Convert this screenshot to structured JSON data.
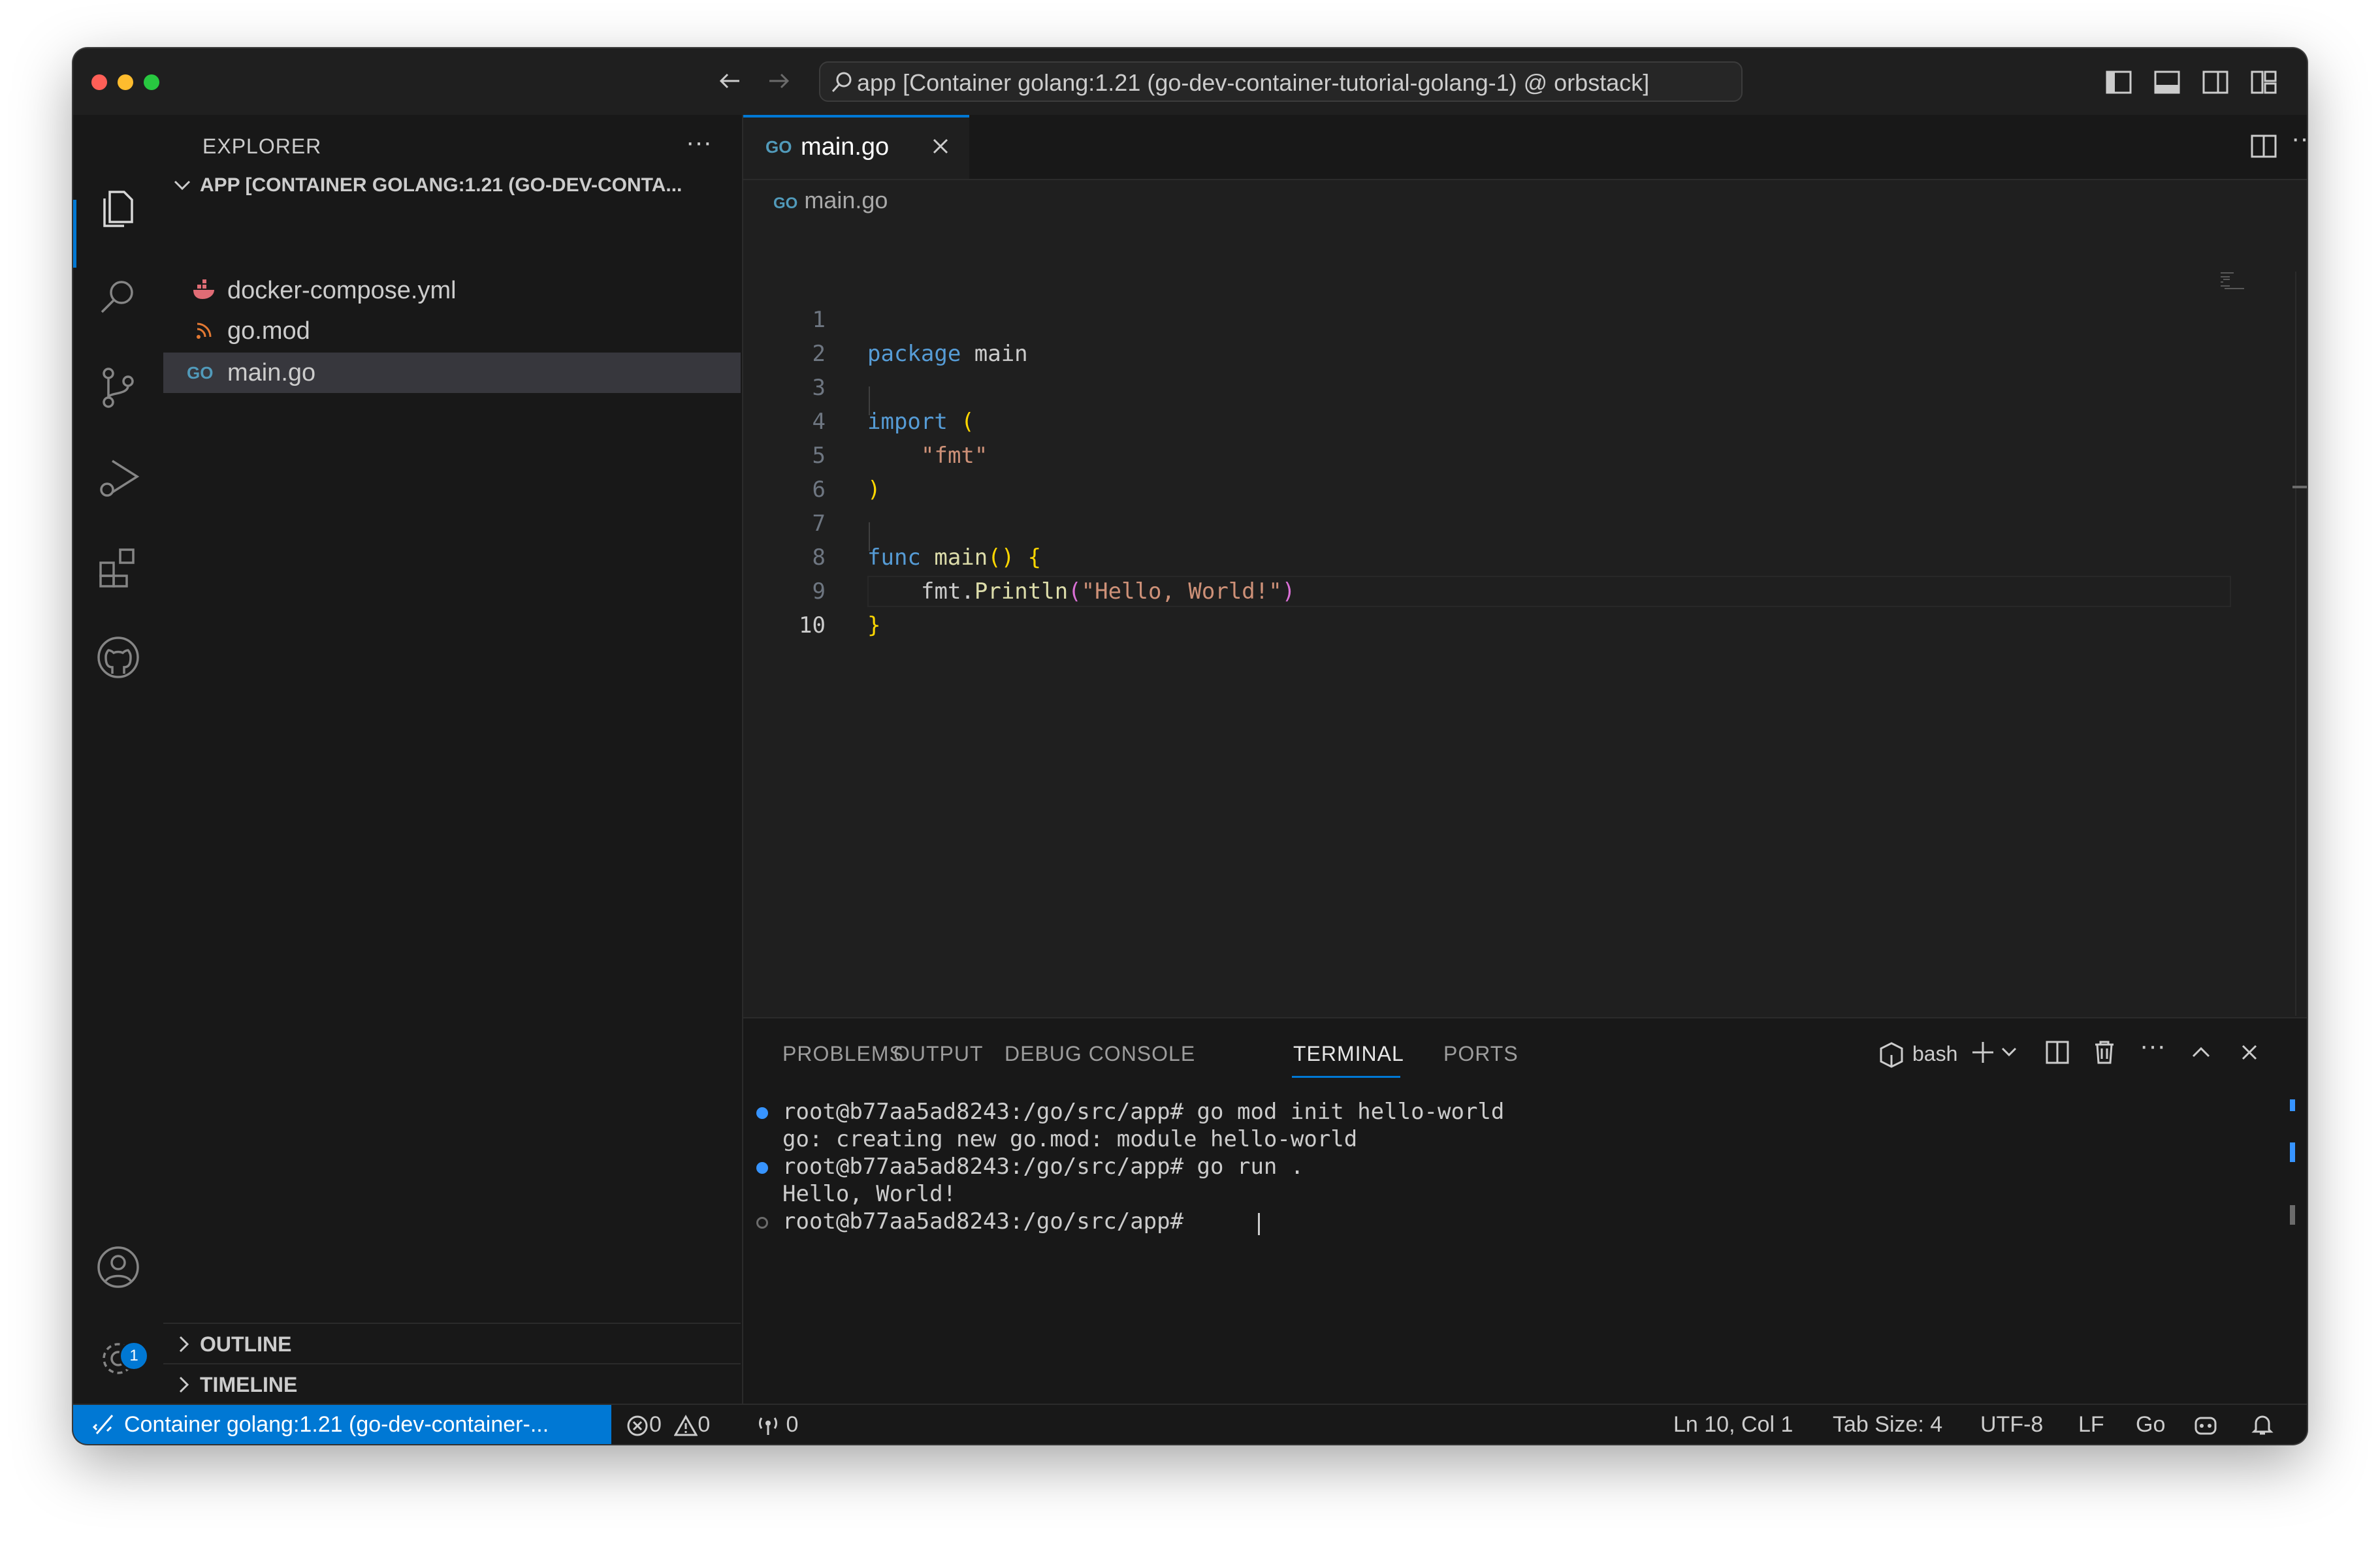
{
  "window": {
    "search_text": "app [Container golang:1.21 (go-dev-container-tutorial-golang-1) @ orbstack]"
  },
  "activity_bar": {
    "items": [
      "explorer-icon",
      "search-icon",
      "source-control-icon",
      "run-debug-icon",
      "extensions-icon",
      "github-icon"
    ],
    "bottom": [
      "accounts-icon",
      "manage-gear-icon"
    ],
    "settings_badge": "1"
  },
  "sidebar": {
    "title": "EXPLORER",
    "more": "···",
    "folder": "APP [CONTAINER GOLANG:1.21 (GO-DEV-CONTA...",
    "files": [
      {
        "name": "docker-compose.yml",
        "icon": "docker-icon"
      },
      {
        "name": "go.mod",
        "icon": "go-mod-icon"
      },
      {
        "name": "main.go",
        "icon": "go-file-icon",
        "selected": true
      }
    ],
    "outline": "OUTLINE",
    "timeline": "TIMELINE"
  },
  "editor": {
    "tab_label": "main.go",
    "tab_icon": "GO",
    "breadcrumb": "main.go",
    "lines": [
      {
        "n": "1"
      },
      {
        "n": "2"
      },
      {
        "n": "3"
      },
      {
        "n": "4"
      },
      {
        "n": "5"
      },
      {
        "n": "6"
      },
      {
        "n": "7"
      },
      {
        "n": "8"
      },
      {
        "n": "9"
      },
      {
        "n": "10"
      }
    ],
    "code": {
      "l1_kw": "package",
      "l1_rest": " main",
      "l3_kw": "import",
      "l3_paren": " (",
      "l4_str": "\"fmt\"",
      "l5_paren": ")",
      "l7_kw": "func",
      "l7_fn": " main",
      "l7_paren": "()",
      "l7_brace": " {",
      "l8_pkg": "fmt.",
      "l8_fn": "Println",
      "l8_open": "(",
      "l8_str": "\"Hello, World!\"",
      "l8_close": ")",
      "l9_brace": "}"
    }
  },
  "panel": {
    "tabs": [
      "PROBLEMS",
      "OUTPUT",
      "DEBUG CONSOLE",
      "TERMINAL",
      "PORTS"
    ],
    "active_tab": "TERMINAL",
    "shell": "bash",
    "terminal_lines": [
      "root@b77aa5ad8243:/go/src/app# go mod init hello-world",
      "go: creating new go.mod: module hello-world",
      "root@b77aa5ad8243:/go/src/app# go run .",
      "Hello, World!",
      "root@b77aa5ad8243:/go/src/app# "
    ]
  },
  "statusbar": {
    "remote": "Container golang:1.21 (go-dev-container-...",
    "errors": "0",
    "warnings": "0",
    "ports": "0",
    "position": "Ln 10, Col 1",
    "tab_size": "Tab Size: 4",
    "encoding": "UTF-8",
    "eol": "LF",
    "language": "Go"
  },
  "colors": {
    "accent": "#0078d4",
    "keyword": "#569cd6",
    "string": "#ce9178",
    "function": "#dcdcaa",
    "bracket": "#ffd700"
  }
}
